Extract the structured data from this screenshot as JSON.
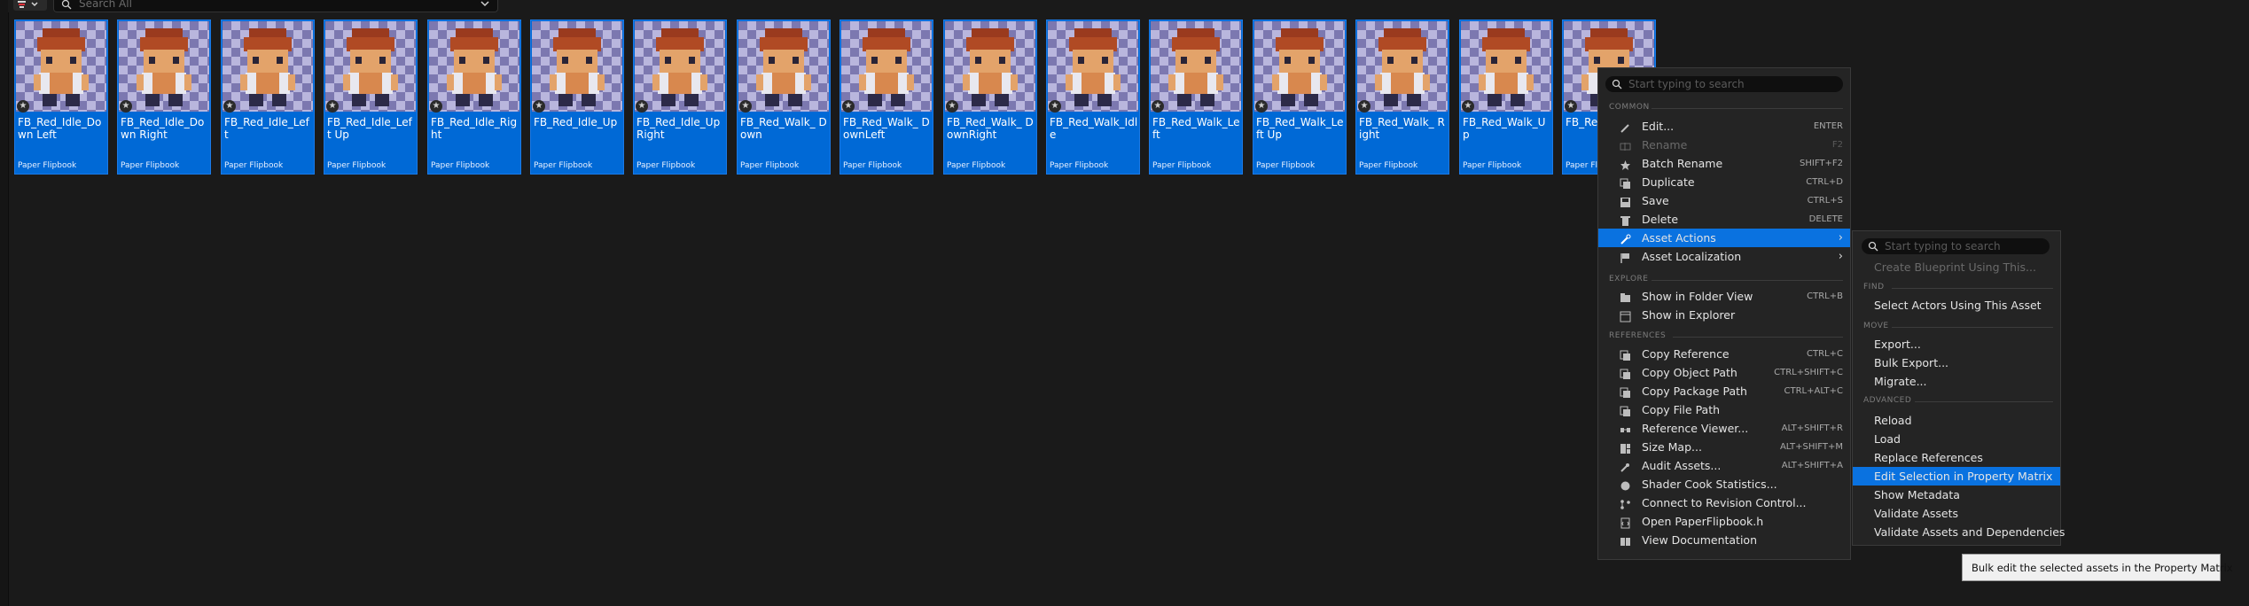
{
  "toolbar": {
    "search_placeholder": "Search All"
  },
  "assets": [
    {
      "name": "FB_Red_Idle_Down Left",
      "type": "Paper Flipbook"
    },
    {
      "name": "FB_Red_Idle_Down Right",
      "type": "Paper Flipbook"
    },
    {
      "name": "FB_Red_Idle_Left",
      "type": "Paper Flipbook"
    },
    {
      "name": "FB_Red_Idle_Left Up",
      "type": "Paper Flipbook"
    },
    {
      "name": "FB_Red_Idle_Right",
      "type": "Paper Flipbook"
    },
    {
      "name": "FB_Red_Idle_Up",
      "type": "Paper Flipbook"
    },
    {
      "name": "FB_Red_Idle_Up Right",
      "type": "Paper Flipbook"
    },
    {
      "name": "FB_Red_Walk_ Down",
      "type": "Paper Flipbook"
    },
    {
      "name": "FB_Red_Walk_ DownLeft",
      "type": "Paper Flipbook"
    },
    {
      "name": "FB_Red_Walk_ DownRight",
      "type": "Paper Flipbook"
    },
    {
      "name": "FB_Red_Walk_Idle",
      "type": "Paper Flipbook"
    },
    {
      "name": "FB_Red_Walk_Left",
      "type": "Paper Flipbook"
    },
    {
      "name": "FB_Red_Walk_Left Up",
      "type": "Paper Flipbook"
    },
    {
      "name": "FB_Red_Walk_ Right",
      "type": "Paper Flipbook"
    },
    {
      "name": "FB_Red_Walk_Up",
      "type": "Paper Flipbook"
    },
    {
      "name": "FB_Re",
      "type": "Paper Flipbo"
    }
  ],
  "context_menu": {
    "search_placeholder": "Start typing to search",
    "sections": {
      "common": "COMMON",
      "explore": "EXPLORE",
      "references": "REFERENCES"
    },
    "items": [
      {
        "label": "Edit...",
        "shortcut": "ENTER",
        "icon": "pencil-icon",
        "disabled": false
      },
      {
        "label": "Rename",
        "shortcut": "F2",
        "icon": "rename-icon",
        "disabled": true
      },
      {
        "label": "Batch Rename",
        "shortcut": "SHIFT+F2",
        "icon": "star-icon",
        "disabled": false
      },
      {
        "label": "Duplicate",
        "shortcut": "CTRL+D",
        "icon": "duplicate-icon",
        "disabled": false
      },
      {
        "label": "Save",
        "shortcut": "CTRL+S",
        "icon": "save-icon",
        "disabled": false
      },
      {
        "label": "Delete",
        "shortcut": "DELETE",
        "icon": "trash-icon",
        "disabled": false
      },
      {
        "label": "Asset Actions",
        "shortcut": "",
        "icon": "wrench-icon",
        "disabled": false,
        "submenu": true,
        "highlighted": true
      },
      {
        "label": "Asset Localization",
        "shortcut": "",
        "icon": "flag-icon",
        "disabled": false,
        "submenu": true
      },
      {
        "label": "Show in Folder View",
        "shortcut": "CTRL+B",
        "icon": "folder-view-icon",
        "disabled": false
      },
      {
        "label": "Show in Explorer",
        "shortcut": "",
        "icon": "explorer-icon",
        "disabled": false
      },
      {
        "label": "Copy Reference",
        "shortcut": "CTRL+C",
        "icon": "copy-icon",
        "disabled": false
      },
      {
        "label": "Copy Object Path",
        "shortcut": "CTRL+SHIFT+C",
        "icon": "copy-icon",
        "disabled": false
      },
      {
        "label": "Copy Package Path",
        "shortcut": "CTRL+ALT+C",
        "icon": "copy-icon",
        "disabled": false
      },
      {
        "label": "Copy File Path",
        "shortcut": "",
        "icon": "copy-icon",
        "disabled": false
      },
      {
        "label": "Reference Viewer...",
        "shortcut": "ALT+SHIFT+R",
        "icon": "reference-viewer-icon",
        "disabled": false
      },
      {
        "label": "Size Map...",
        "shortcut": "ALT+SHIFT+M",
        "icon": "size-map-icon",
        "disabled": false
      },
      {
        "label": "Audit Assets...",
        "shortcut": "ALT+SHIFT+A",
        "icon": "audit-icon",
        "disabled": false
      },
      {
        "label": "Shader Cook Statistics...",
        "shortcut": "",
        "icon": "shader-icon",
        "disabled": false
      },
      {
        "label": "Connect to Revision Control...",
        "shortcut": "",
        "icon": "revision-control-icon",
        "disabled": false
      },
      {
        "label": "Open PaperFlipbook.h",
        "shortcut": "",
        "icon": "code-file-icon",
        "disabled": false
      },
      {
        "label": "View Documentation",
        "shortcut": "",
        "icon": "book-icon",
        "disabled": false
      }
    ]
  },
  "submenu": {
    "search_placeholder": "Start typing to search",
    "sections": {
      "find": "FIND",
      "move": "MOVE",
      "advanced": "ADVANCED"
    },
    "items": [
      {
        "label": "Create Blueprint Using This...",
        "disabled": true
      },
      {
        "label": "Select Actors Using This Asset",
        "disabled": false
      },
      {
        "label": "Export...",
        "disabled": false
      },
      {
        "label": "Bulk Export...",
        "disabled": false
      },
      {
        "label": "Migrate...",
        "disabled": false
      },
      {
        "label": "Reload",
        "disabled": false
      },
      {
        "label": "Load",
        "disabled": false
      },
      {
        "label": "Replace References",
        "disabled": false
      },
      {
        "label": "Edit Selection in Property Matrix",
        "disabled": false,
        "highlighted": true
      },
      {
        "label": "Show Metadata",
        "disabled": false
      },
      {
        "label": "Validate Assets",
        "disabled": false
      },
      {
        "label": "Validate Assets and Dependencies",
        "disabled": false
      }
    ]
  },
  "tooltip": {
    "text": "Bulk edit the selected assets in the Property Matrix"
  },
  "colors": {
    "selection": "#0069d6",
    "menu_bg": "#242424",
    "highlight": "#0a72e0"
  }
}
